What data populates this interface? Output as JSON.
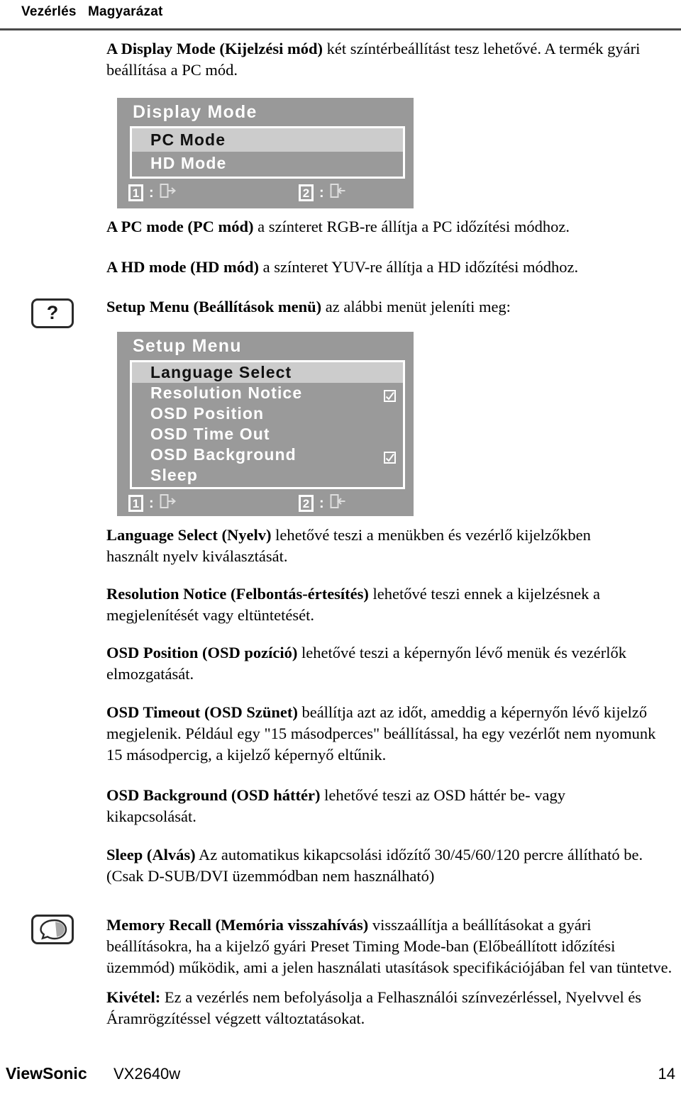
{
  "header": {
    "col_control": "Vezérlés",
    "col_explanation": "Magyarázat"
  },
  "icons": {
    "help": "question-mark-icon",
    "memory": "memory-recall-icon"
  },
  "paragraphs": {
    "display_mode": {
      "bold": "A Display Mode (Kijelzési mód)",
      "rest": " két színtérbeállítást tesz lehetővé. A termék gyári beállítása a PC mód."
    },
    "pc_mode": {
      "bold": "A PC mode (PC mód)",
      "rest": " a színteret RGB-re állítja a PC időzítési módhoz."
    },
    "hd_mode": {
      "bold": "A HD mode (HD mód)",
      "rest": " a színteret YUV-re állítja a HD időzítési módhoz."
    },
    "setup_menu": {
      "bold": "Setup Menu (Beállítások menü)",
      "rest": " az alábbi menüt jeleníti meg:"
    },
    "language_select": {
      "bold": "Language Select (Nyelv)",
      "rest": " lehetővé teszi a menükben és vezérlő kijelzőkben használt nyelv kiválasztását."
    },
    "resolution_notice": {
      "bold": "Resolution Notice (Felbontás-értesítés)",
      "rest": " lehetővé teszi ennek a kijelzésnek a megjelenítését vagy eltüntetését."
    },
    "osd_position": {
      "bold": "OSD Position (OSD pozíció)",
      "rest": " lehetővé teszi a képernyőn lévő menük és vezérlők elmozgatását."
    },
    "osd_timeout": {
      "bold": "OSD Timeout (OSD Szünet)",
      "rest": " beállítja azt az időt, ameddig a képernyőn lévő kijelző megjelenik. Például egy \"15 másodperces\" beállítással, ha egy vezérlőt nem nyomunk 15 másodpercig, a kijelző képernyő eltűnik."
    },
    "osd_background": {
      "bold": "OSD Background (OSD háttér)",
      "rest": " lehetővé teszi az OSD háttér be- vagy kikapcsolását."
    },
    "sleep": {
      "bold": "Sleep (Alvás)",
      "rest": " Az automatikus kikapcsolási időzítő 30/45/60/120 percre állítható be. (Csak D-SUB/DVI üzemmódban nem használható)"
    },
    "memory_recall": {
      "bold": "Memory Recall (Memória visszahívás)",
      "rest": " visszaállítja a beállításokat a gyári beállításokra, ha a kijelző gyári Preset Timing Mode-ban (Előbeállított időzítési üzemmód) működik, ami a jelen használati utasítások specifikációjában fel van tüntetve."
    },
    "exception": {
      "bold": "Kivétel:",
      "rest": " Ez a vezérlés nem befolyásolja a Felhasználói színvezérléssel, Nyelvvel és Áramrögzítéssel végzett változtatásokat."
    }
  },
  "osd_display_mode": {
    "title": "Display Mode",
    "rows": [
      {
        "label": "PC Mode",
        "selected": true,
        "checkbox": false
      },
      {
        "label": "HD Mode",
        "selected": false,
        "checkbox": false
      }
    ],
    "keys": [
      {
        "num": "1",
        "colon": ":",
        "icon": "exit-door-icon"
      },
      {
        "num": "2",
        "colon": ":",
        "icon": "enter-door-icon"
      }
    ]
  },
  "osd_setup_menu": {
    "title": "Setup Menu",
    "rows": [
      {
        "label": "Language Select",
        "selected": true,
        "checkbox": false
      },
      {
        "label": "Resolution Notice",
        "selected": false,
        "checkbox": true
      },
      {
        "label": "OSD Position",
        "selected": false,
        "checkbox": false
      },
      {
        "label": "OSD Time Out",
        "selected": false,
        "checkbox": false
      },
      {
        "label": "OSD Background",
        "selected": false,
        "checkbox": true
      },
      {
        "label": "Sleep",
        "selected": false,
        "checkbox": false
      }
    ],
    "keys": [
      {
        "num": "1",
        "colon": ":",
        "icon": "exit-door-icon"
      },
      {
        "num": "2",
        "colon": ":",
        "icon": "enter-door-icon"
      }
    ]
  },
  "footer": {
    "brand": "ViewSonic",
    "model": "VX2640w",
    "page": "14"
  },
  "colors": {
    "osd_panel": "#999999",
    "osd_row_selected": "#cccccc",
    "osd_border": "#ffffff",
    "rule": "#4a4a4a"
  }
}
